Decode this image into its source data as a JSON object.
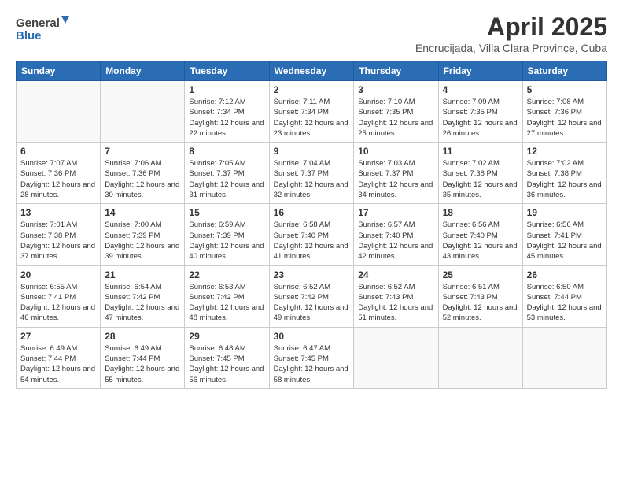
{
  "logo": {
    "line1": "General",
    "line2": "Blue"
  },
  "title": "April 2025",
  "subtitle": "Encrucijada, Villa Clara Province, Cuba",
  "days_of_week": [
    "Sunday",
    "Monday",
    "Tuesday",
    "Wednesday",
    "Thursday",
    "Friday",
    "Saturday"
  ],
  "weeks": [
    [
      {
        "day": "",
        "info": ""
      },
      {
        "day": "",
        "info": ""
      },
      {
        "day": "1",
        "info": "Sunrise: 7:12 AM\nSunset: 7:34 PM\nDaylight: 12 hours and 22 minutes."
      },
      {
        "day": "2",
        "info": "Sunrise: 7:11 AM\nSunset: 7:34 PM\nDaylight: 12 hours and 23 minutes."
      },
      {
        "day": "3",
        "info": "Sunrise: 7:10 AM\nSunset: 7:35 PM\nDaylight: 12 hours and 25 minutes."
      },
      {
        "day": "4",
        "info": "Sunrise: 7:09 AM\nSunset: 7:35 PM\nDaylight: 12 hours and 26 minutes."
      },
      {
        "day": "5",
        "info": "Sunrise: 7:08 AM\nSunset: 7:36 PM\nDaylight: 12 hours and 27 minutes."
      }
    ],
    [
      {
        "day": "6",
        "info": "Sunrise: 7:07 AM\nSunset: 7:36 PM\nDaylight: 12 hours and 28 minutes."
      },
      {
        "day": "7",
        "info": "Sunrise: 7:06 AM\nSunset: 7:36 PM\nDaylight: 12 hours and 30 minutes."
      },
      {
        "day": "8",
        "info": "Sunrise: 7:05 AM\nSunset: 7:37 PM\nDaylight: 12 hours and 31 minutes."
      },
      {
        "day": "9",
        "info": "Sunrise: 7:04 AM\nSunset: 7:37 PM\nDaylight: 12 hours and 32 minutes."
      },
      {
        "day": "10",
        "info": "Sunrise: 7:03 AM\nSunset: 7:37 PM\nDaylight: 12 hours and 34 minutes."
      },
      {
        "day": "11",
        "info": "Sunrise: 7:02 AM\nSunset: 7:38 PM\nDaylight: 12 hours and 35 minutes."
      },
      {
        "day": "12",
        "info": "Sunrise: 7:02 AM\nSunset: 7:38 PM\nDaylight: 12 hours and 36 minutes."
      }
    ],
    [
      {
        "day": "13",
        "info": "Sunrise: 7:01 AM\nSunset: 7:38 PM\nDaylight: 12 hours and 37 minutes."
      },
      {
        "day": "14",
        "info": "Sunrise: 7:00 AM\nSunset: 7:39 PM\nDaylight: 12 hours and 39 minutes."
      },
      {
        "day": "15",
        "info": "Sunrise: 6:59 AM\nSunset: 7:39 PM\nDaylight: 12 hours and 40 minutes."
      },
      {
        "day": "16",
        "info": "Sunrise: 6:58 AM\nSunset: 7:40 PM\nDaylight: 12 hours and 41 minutes."
      },
      {
        "day": "17",
        "info": "Sunrise: 6:57 AM\nSunset: 7:40 PM\nDaylight: 12 hours and 42 minutes."
      },
      {
        "day": "18",
        "info": "Sunrise: 6:56 AM\nSunset: 7:40 PM\nDaylight: 12 hours and 43 minutes."
      },
      {
        "day": "19",
        "info": "Sunrise: 6:56 AM\nSunset: 7:41 PM\nDaylight: 12 hours and 45 minutes."
      }
    ],
    [
      {
        "day": "20",
        "info": "Sunrise: 6:55 AM\nSunset: 7:41 PM\nDaylight: 12 hours and 46 minutes."
      },
      {
        "day": "21",
        "info": "Sunrise: 6:54 AM\nSunset: 7:42 PM\nDaylight: 12 hours and 47 minutes."
      },
      {
        "day": "22",
        "info": "Sunrise: 6:53 AM\nSunset: 7:42 PM\nDaylight: 12 hours and 48 minutes."
      },
      {
        "day": "23",
        "info": "Sunrise: 6:52 AM\nSunset: 7:42 PM\nDaylight: 12 hours and 49 minutes."
      },
      {
        "day": "24",
        "info": "Sunrise: 6:52 AM\nSunset: 7:43 PM\nDaylight: 12 hours and 51 minutes."
      },
      {
        "day": "25",
        "info": "Sunrise: 6:51 AM\nSunset: 7:43 PM\nDaylight: 12 hours and 52 minutes."
      },
      {
        "day": "26",
        "info": "Sunrise: 6:50 AM\nSunset: 7:44 PM\nDaylight: 12 hours and 53 minutes."
      }
    ],
    [
      {
        "day": "27",
        "info": "Sunrise: 6:49 AM\nSunset: 7:44 PM\nDaylight: 12 hours and 54 minutes."
      },
      {
        "day": "28",
        "info": "Sunrise: 6:49 AM\nSunset: 7:44 PM\nDaylight: 12 hours and 55 minutes."
      },
      {
        "day": "29",
        "info": "Sunrise: 6:48 AM\nSunset: 7:45 PM\nDaylight: 12 hours and 56 minutes."
      },
      {
        "day": "30",
        "info": "Sunrise: 6:47 AM\nSunset: 7:45 PM\nDaylight: 12 hours and 58 minutes."
      },
      {
        "day": "",
        "info": ""
      },
      {
        "day": "",
        "info": ""
      },
      {
        "day": "",
        "info": ""
      }
    ]
  ]
}
